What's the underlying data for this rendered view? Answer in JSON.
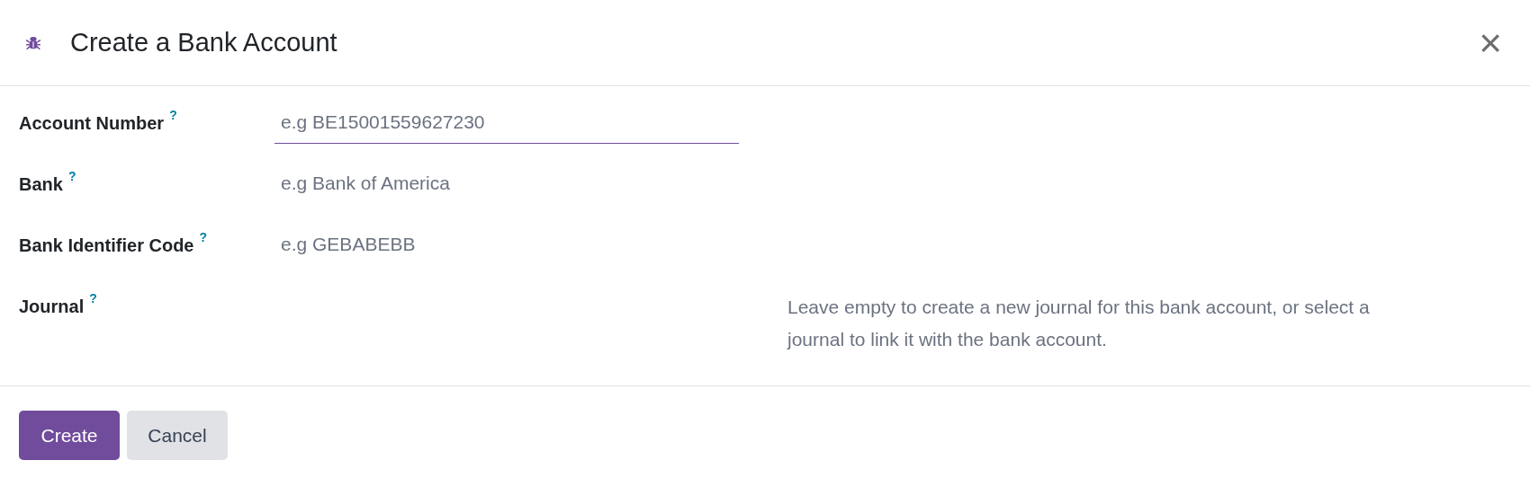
{
  "dialog": {
    "title": "Create a Bank Account",
    "close": "×",
    "fields": [
      {
        "kind": "input",
        "label": "Account Number",
        "help_mark": "?",
        "placeholder": "e.g BE15001559627230",
        "focused": true
      },
      {
        "kind": "input",
        "label": "Bank",
        "help_mark": "?",
        "placeholder": "e.g Bank of America",
        "focused": false
      },
      {
        "kind": "input",
        "label": "Bank Identifier Code",
        "help_mark": "?",
        "placeholder": "e.g GEBABEBB",
        "focused": false
      },
      {
        "kind": "note",
        "label": "Journal",
        "help_mark": "?",
        "note": "Leave empty to create a new journal for this bank account, or select a journal to link it with the bank account."
      }
    ],
    "buttons": [
      {
        "label": "Create",
        "kind": "primary"
      },
      {
        "label": "Cancel",
        "kind": "secondary"
      }
    ]
  }
}
